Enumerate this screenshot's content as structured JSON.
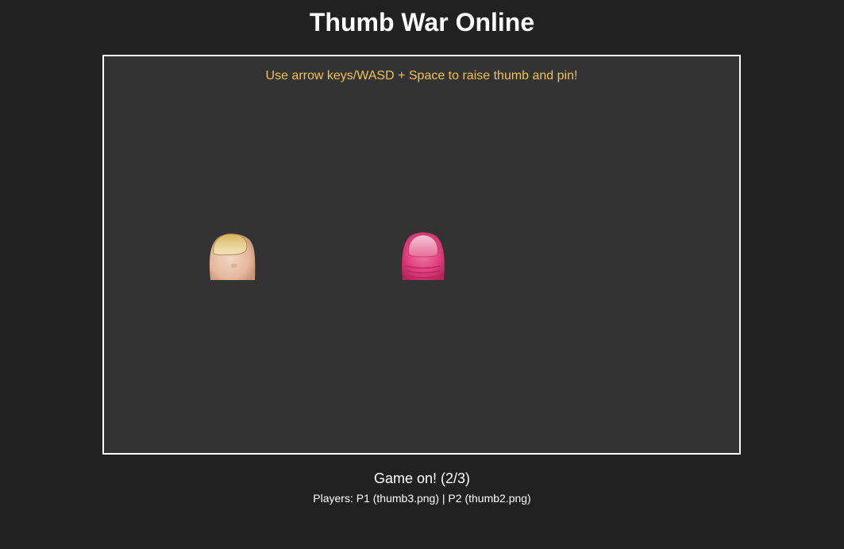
{
  "header": {
    "title": "Thumb War Online"
  },
  "board": {
    "instructions": "Use arrow keys/WASD + Space to raise thumb and pin!",
    "background_color": "#333333",
    "instructions_color": "#f0c24f"
  },
  "players": [
    {
      "id": "P1",
      "sprite_icon": "pale-thumb-icon"
    },
    {
      "id": "P2",
      "sprite_icon": "pink-thumb-icon"
    }
  ],
  "footer": {
    "status": "Game on! (2/3)",
    "players_line": "Players: P1 (thumb3.png) | P2 (thumb2.png)"
  }
}
